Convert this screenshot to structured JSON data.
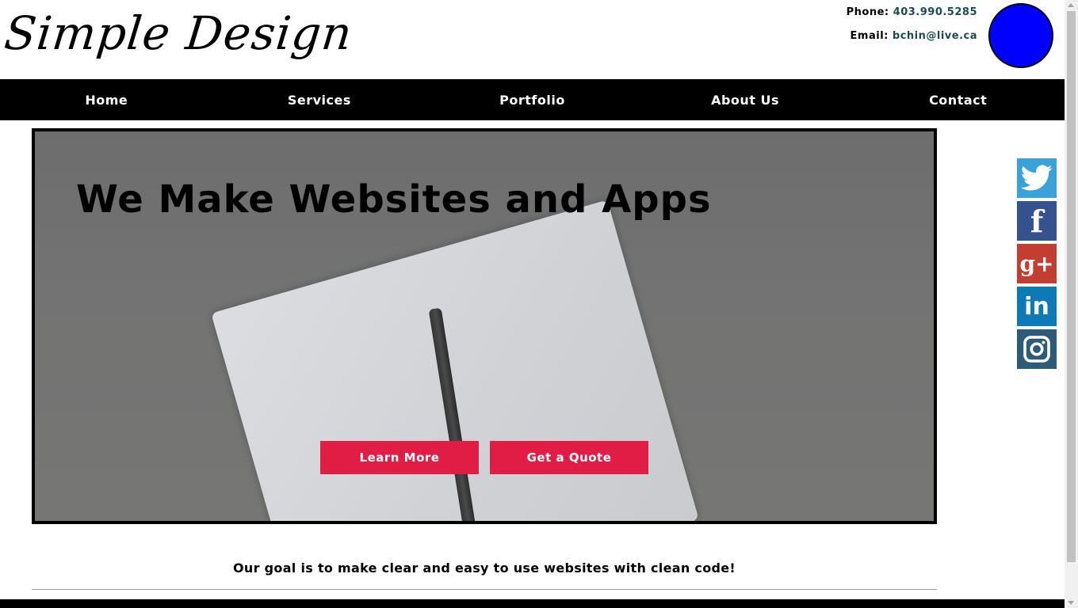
{
  "header": {
    "logo_text": "Simple Design",
    "phone_label": "Phone:",
    "phone_value": "403.990.5285",
    "email_label": "Email:",
    "email_value": "bchin@live.ca"
  },
  "nav": {
    "items": [
      "Home",
      "Services",
      "Portfolio",
      "About Us",
      "Contact"
    ]
  },
  "hero": {
    "title": "We Make Websites and Apps",
    "learn_more": "Learn More",
    "get_quote": "Get a Quote"
  },
  "social": [
    "twitter-icon",
    "facebook-icon",
    "google-plus-icon",
    "linkedin-icon",
    "instagram-icon"
  ],
  "tagline": "Our goal is to make clear and easy to use websites with clean code!",
  "colors": {
    "nav_bg": "#000000",
    "accent_button": "#e01d45",
    "avatar": "#0000ff",
    "contact_value": "#1d4b52"
  }
}
